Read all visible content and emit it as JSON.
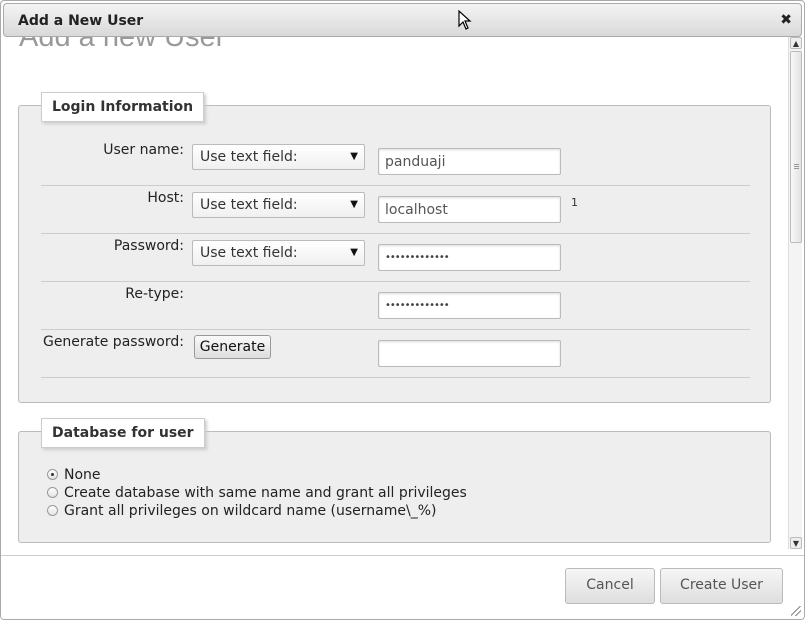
{
  "dialog": {
    "title": "Add a New User",
    "close_glyph": "✖"
  },
  "page": {
    "heading": "Add a new User"
  },
  "login": {
    "legend": "Login Information",
    "username": {
      "label": "User name:",
      "select_value": "Use text field:",
      "value": "panduaji"
    },
    "host": {
      "label": "Host:",
      "select_value": "Use text field:",
      "value": "localhost",
      "footnote": "1"
    },
    "password": {
      "label": "Password:",
      "select_value": "Use text field:",
      "value": "•••••••••••••"
    },
    "retype": {
      "label": "Re-type:",
      "value": "•••••••••••••"
    },
    "generate": {
      "label": "Generate password:",
      "button": "Generate",
      "value": ""
    }
  },
  "database": {
    "legend": "Database for user",
    "options": [
      {
        "label": "None",
        "checked": true
      },
      {
        "label": "Create database with same name and grant all privileges",
        "checked": false
      },
      {
        "label": "Grant all privileges on wildcard name (username\\_%)",
        "checked": false
      }
    ]
  },
  "footer": {
    "cancel": "Cancel",
    "create": "Create User"
  },
  "icons": {
    "dropdown": "chevron-down-icon",
    "close": "close-icon",
    "resize": "resize-grip-icon",
    "cursor": "mouse-pointer-icon"
  }
}
